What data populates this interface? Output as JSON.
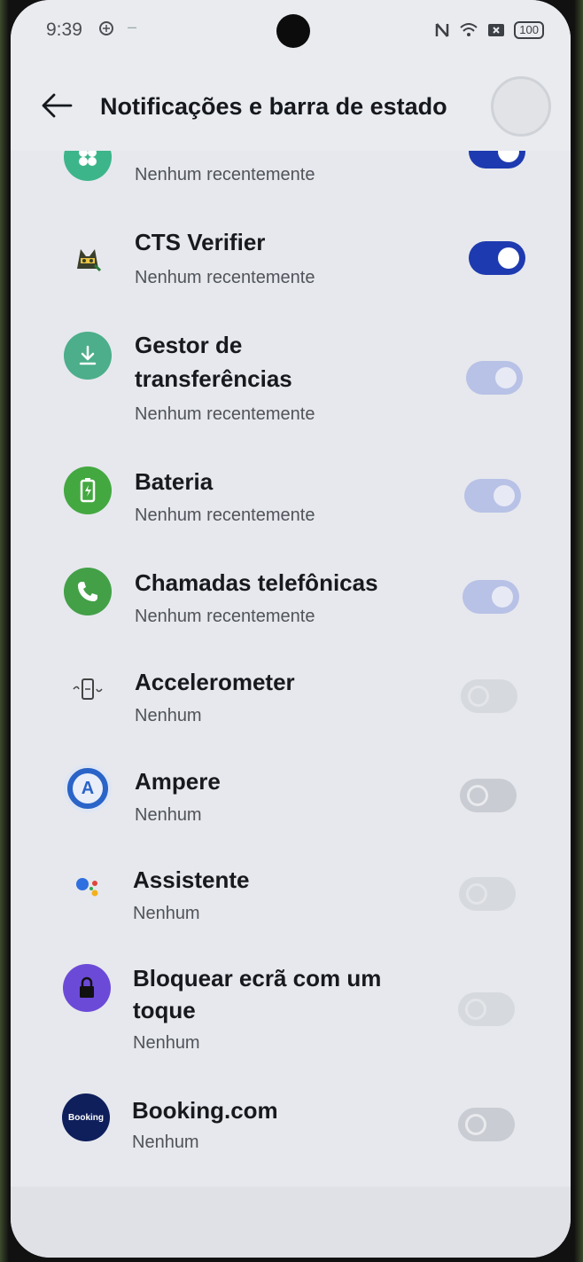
{
  "status_bar": {
    "time": "9:39",
    "battery": "100"
  },
  "header": {
    "title": "Notificações e barra de estado"
  },
  "apps": [
    {
      "name": "",
      "subtitle": "Nenhum recentemente",
      "icon": "clover-app-icon",
      "toggle": "on"
    },
    {
      "name": "CTS Verifier",
      "subtitle": "Nenhum recentemente",
      "icon": "cts-verifier-icon",
      "toggle": "on"
    },
    {
      "name": "Gestor de transferências",
      "subtitle": "Nenhum recentemente",
      "icon": "download-icon",
      "toggle": "on-disabled"
    },
    {
      "name": "Bateria",
      "subtitle": "Nenhum recentemente",
      "icon": "battery-icon",
      "toggle": "on-disabled"
    },
    {
      "name": "Chamadas telefônicas",
      "subtitle": "Nenhum recentemente",
      "icon": "phone-icon",
      "toggle": "on-disabled"
    },
    {
      "name": "Accelerometer",
      "subtitle": "Nenhum",
      "icon": "accelerometer-icon",
      "toggle": "off-disabled"
    },
    {
      "name": "Ampere",
      "subtitle": "Nenhum",
      "icon": "ampere-icon",
      "toggle": "off"
    },
    {
      "name": "Assistente",
      "subtitle": "Nenhum",
      "icon": "assistant-icon",
      "toggle": "off-disabled"
    },
    {
      "name": "Bloquear ecrã com um toque",
      "subtitle": "Nenhum",
      "icon": "lock-icon",
      "toggle": "off-disabled"
    },
    {
      "name": "Booking.com",
      "subtitle": "Nenhum",
      "icon": "booking-icon",
      "icon_text": "Booking",
      "toggle": "off"
    }
  ],
  "colors": {
    "toggle_on": "#1e3ab0",
    "accent_green": "#43a047",
    "booking_blue": "#0f1f5c"
  }
}
